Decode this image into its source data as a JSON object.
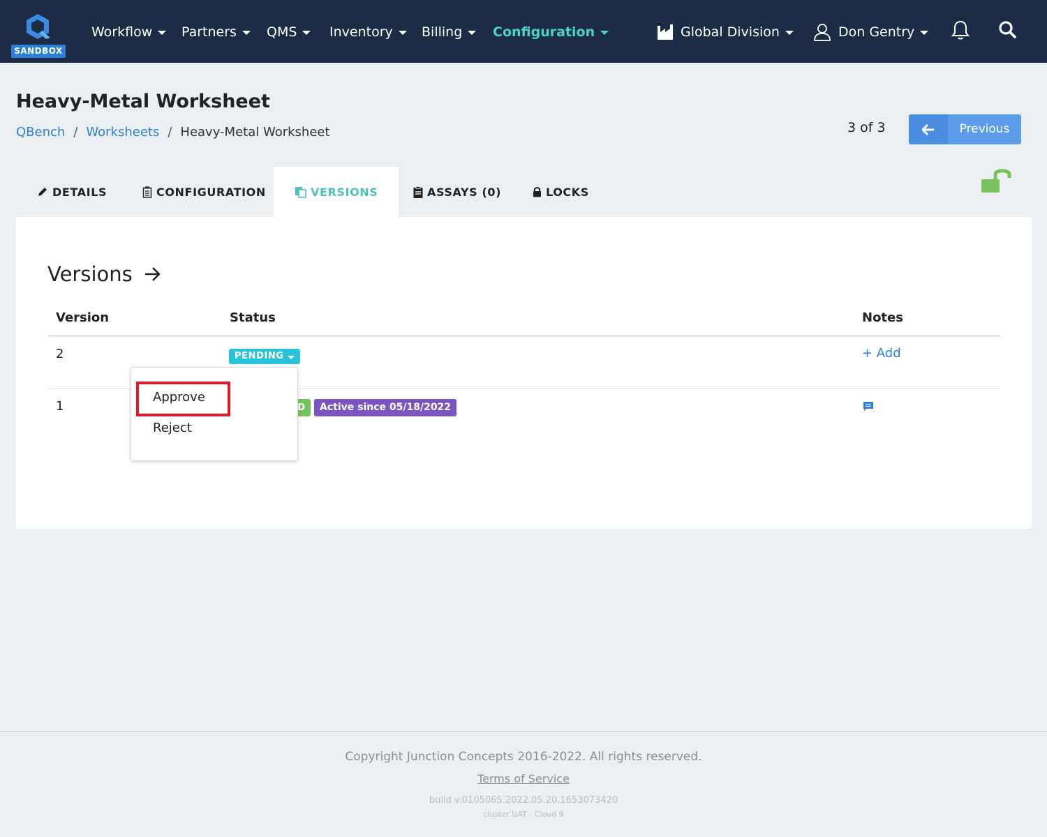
{
  "navbar": {
    "badge": "SANDBOX",
    "items": [
      {
        "label": "Workflow"
      },
      {
        "label": "Partners"
      },
      {
        "label": "QMS"
      },
      {
        "label": "Inventory"
      },
      {
        "label": "Billing"
      },
      {
        "label": "Configuration",
        "active": true
      }
    ],
    "division": "Global Division",
    "user": "Don Gentry",
    "colors": {
      "background": "#1d2c45",
      "active": "#4dd0c8",
      "sandbox": "#2c7fd6"
    },
    "icons": [
      "logo-icon",
      "factory-icon",
      "user-icon",
      "bell-icon",
      "search-icon"
    ]
  },
  "header": {
    "title": "Heavy-Metal Worksheet",
    "breadcrumb": [
      "QBench",
      "Worksheets",
      "Heavy-Metal Worksheet"
    ],
    "pager": "3 of 3",
    "previous_label": "Previous"
  },
  "tabs": [
    {
      "label": "DETAILS",
      "icon": "pencil-icon"
    },
    {
      "label": "CONFIGURATION",
      "icon": "clipboard-icon"
    },
    {
      "label": "VERSIONS",
      "icon": "copy-icon",
      "active": true
    },
    {
      "label": "ASSAYS (0)",
      "icon": "clipboard-list-icon"
    },
    {
      "label": "LOCKS",
      "icon": "lock-icon"
    }
  ],
  "versions": {
    "title": "Versions",
    "columns": [
      "Version",
      "Status",
      "Notes"
    ],
    "rows": [
      {
        "version": "2",
        "status": "PENDING",
        "notes": "+ Add"
      },
      {
        "version": "1",
        "status_fragment": "D",
        "active": "Active since 05/18/2022",
        "notes_icon": "comment-icon"
      }
    ]
  },
  "dropdown": {
    "items": [
      "Approve",
      "Reject"
    ],
    "highlighted": "Approve"
  },
  "footer": {
    "copyright": "Copyright Junction Concepts 2016-2022. All rights reserved.",
    "tos": "Terms of Service",
    "build": "build v.0105065.2022.05.20.1653073420",
    "cluster": "cluster UAT - Cloud 9"
  }
}
